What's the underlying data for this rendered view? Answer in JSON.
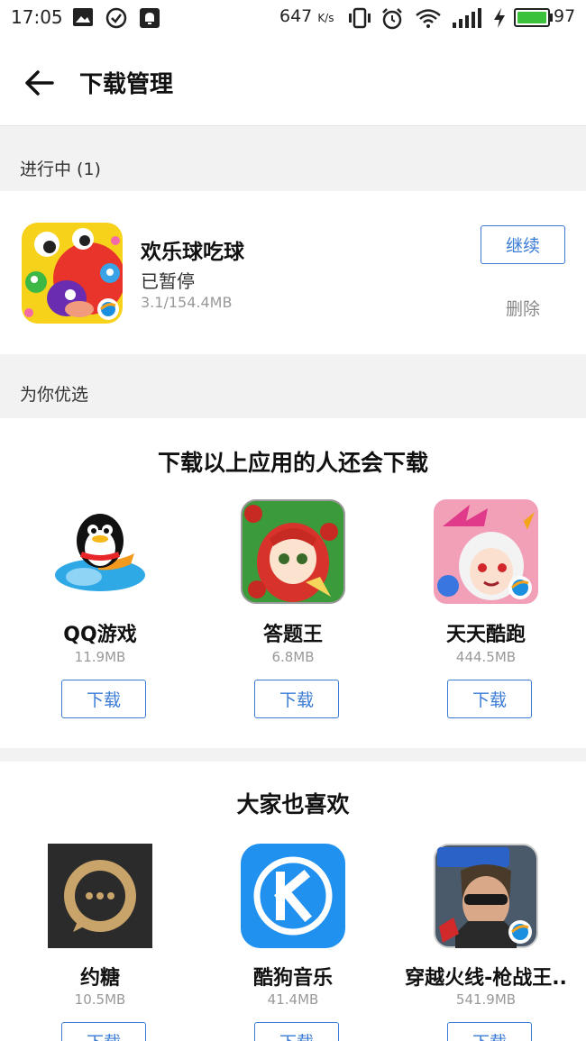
{
  "status_bar": {
    "time": "17:05",
    "net_speed": "647",
    "net_unit": "K/s",
    "battery": "97"
  },
  "header": {
    "title": "下载管理"
  },
  "in_progress": {
    "label": "进行中 (1)",
    "item": {
      "name": "欢乐球吃球",
      "status": "已暂停",
      "size": "3.1/154.4MB",
      "continue_label": "继续",
      "delete_label": "删除"
    }
  },
  "for_you": {
    "label": "为你优选"
  },
  "section1": {
    "title": "下载以上应用的人还会下载",
    "apps": [
      {
        "name": "QQ游戏",
        "size": "11.9MB",
        "button": "下载",
        "icon": "qq-game-icon"
      },
      {
        "name": "答题王",
        "size": "6.8MB",
        "button": "下载",
        "icon": "datiwang-icon"
      },
      {
        "name": "天天酷跑",
        "size": "444.5MB",
        "button": "下载",
        "icon": "tiantian-kupao-icon"
      }
    ]
  },
  "section2": {
    "title": "大家也喜欢",
    "apps": [
      {
        "name": "约糖",
        "size": "10.5MB",
        "button": "下载",
        "icon": "yuetang-icon"
      },
      {
        "name": "酷狗音乐",
        "size": "41.4MB",
        "button": "下载",
        "icon": "kugou-icon"
      },
      {
        "name": "穿越火线-枪战王..",
        "size": "541.9MB",
        "button": "下载",
        "icon": "cf-icon"
      }
    ]
  },
  "colors": {
    "accent": "#3a7bd5",
    "battery": "#3cc13c"
  }
}
